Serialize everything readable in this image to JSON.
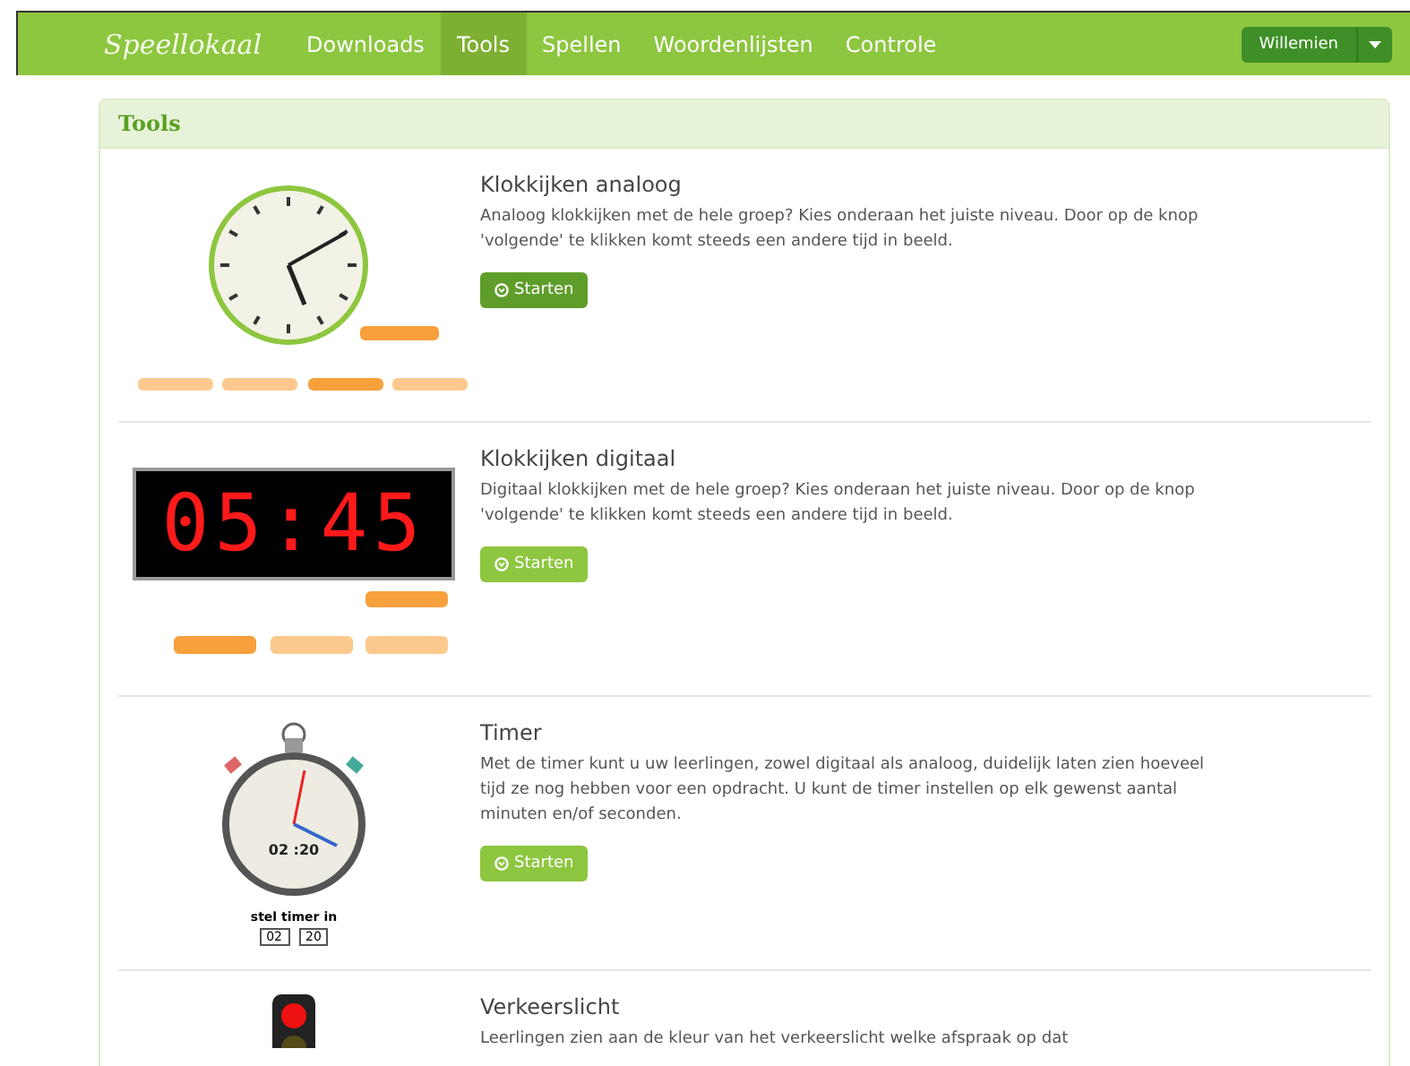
{
  "navbar": {
    "logo": "Speellokaal",
    "items": [
      {
        "label": "Downloads",
        "selected": false
      },
      {
        "label": "Tools",
        "selected": true
      },
      {
        "label": "Spellen",
        "selected": false
      },
      {
        "label": "Woordenlijsten",
        "selected": false
      },
      {
        "label": "Controle",
        "selected": false
      }
    ],
    "user_button": {
      "label": "Willemien"
    }
  },
  "panel": {
    "title": "Tools",
    "items": [
      {
        "title": "Klokkijken analoog",
        "description": "Analoog klokkijken met de hele groep? Kies onderaan het juiste niveau. Door op de knop 'volgende' te klikken komt steeds een andere tijd in beeld.",
        "button": {
          "label": "Starten",
          "active": true
        },
        "image": {
          "kind": "analog-clock"
        }
      },
      {
        "title": "Klokkijken digitaal",
        "description": "Digitaal klokkijken met de hele groep? Kies onderaan het juiste niveau. Door op de knop 'volgende' te klikken komt steeds een andere tijd in beeld.",
        "button": {
          "label": "Starten",
          "active": false
        },
        "image": {
          "kind": "digital-clock",
          "display": "05:45"
        }
      },
      {
        "title": "Timer",
        "description": "Met de timer kunt u uw leerlingen, zowel digitaal als analoog, duidelijk laten zien hoeveel tijd ze nog hebben voor een opdracht. U kunt de timer instellen op elk gewenst aantal minuten en/of seconden.",
        "button": {
          "label": "Starten",
          "active": false
        },
        "image": {
          "kind": "stopwatch",
          "readout": "02 :20",
          "caption": "stel timer in",
          "minutes": "02",
          "seconds": "20"
        }
      },
      {
        "title": "Verkeerslicht",
        "description": "Leerlingen zien aan de kleur van het verkeerslicht welke afspraak op dat",
        "image": {
          "kind": "traffic-light"
        }
      }
    ]
  }
}
